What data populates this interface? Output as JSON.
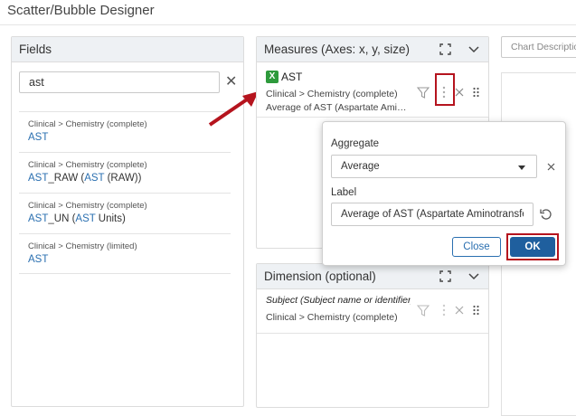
{
  "window": {
    "title": "Scatter/Bubble Designer"
  },
  "fields_panel": {
    "title": "Fields",
    "search": {
      "value": "ast"
    },
    "items": [
      {
        "path": "Clinical > Chemistry (complete)",
        "name_parts": [
          "AST"
        ]
      },
      {
        "path": "Clinical > Chemistry (complete)",
        "name_parts": [
          "AST",
          "_RAW (",
          "AST",
          " (RAW))"
        ]
      },
      {
        "path": "Clinical > Chemistry (complete)",
        "name_parts": [
          "AST",
          "_UN (",
          "AST",
          " Units)"
        ]
      },
      {
        "path": "Clinical > Chemistry (limited)",
        "name_parts": [
          "AST"
        ]
      }
    ]
  },
  "measures_panel": {
    "title": "Measures (Axes: x, y, size)",
    "item": {
      "badge": "X",
      "name": "AST",
      "path": "Clinical > Chemistry (complete)",
      "label": "Average of AST (Aspartate Aminotransferase)"
    }
  },
  "dimension_panel": {
    "title": "Dimension (optional)",
    "item": {
      "title": "Subject (Subject name or identifier)",
      "path": "Clinical > Chemistry (complete)"
    }
  },
  "chart_description": {
    "placeholder": "Chart Description"
  },
  "popup": {
    "aggregate_label": "Aggregate",
    "aggregate_value": "Average",
    "label_label": "Label",
    "label_value": "Average of AST (Aspartate Aminotransferase)",
    "close_label": "Close",
    "ok_label": "OK"
  },
  "colors": {
    "accent": "#1f5f9e",
    "link": "#2a6fb0",
    "highlight": "#b5141e",
    "badge": "#2e9a3c"
  }
}
